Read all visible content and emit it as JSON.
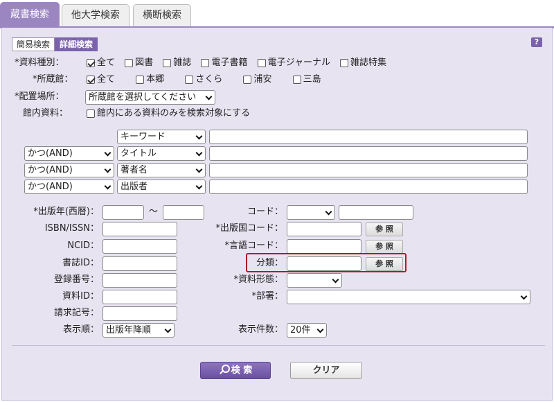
{
  "tabs": [
    {
      "label": "蔵書検索",
      "active": true
    },
    {
      "label": "他大学検索",
      "active": false
    },
    {
      "label": "横断検索",
      "active": false
    }
  ],
  "mode_tabs": [
    {
      "label": "簡易検索",
      "active": false
    },
    {
      "label": "詳細検索",
      "active": true
    }
  ],
  "help": "?",
  "material_type": {
    "label": "*資料種別：",
    "options": [
      {
        "label": "全て",
        "checked": true
      },
      {
        "label": "図書",
        "checked": false
      },
      {
        "label": "雑誌",
        "checked": false
      },
      {
        "label": "電子書籍",
        "checked": false
      },
      {
        "label": "電子ジャーナル",
        "checked": false
      },
      {
        "label": "雑誌特集",
        "checked": false
      }
    ]
  },
  "library": {
    "label": "*所蔵館：",
    "options": [
      {
        "label": "全て",
        "checked": true
      },
      {
        "label": "本郷",
        "checked": false
      },
      {
        "label": "さくら",
        "checked": false
      },
      {
        "label": "浦安",
        "checked": false
      },
      {
        "label": "三島",
        "checked": false
      }
    ]
  },
  "location": {
    "label": "*配置場所：",
    "value": "所蔵館を選択してください"
  },
  "in_library": {
    "label": "館内資料：",
    "option": "館内にある資料のみを検索対象にする",
    "checked": false
  },
  "keyword_rows": [
    {
      "operator": "",
      "field": "キーワード",
      "value": ""
    },
    {
      "operator": "かつ(AND)",
      "field": "タイトル",
      "value": ""
    },
    {
      "operator": "かつ(AND)",
      "field": "著者名",
      "value": ""
    },
    {
      "operator": "かつ(AND)",
      "field": "出版者",
      "value": ""
    }
  ],
  "left_fields": {
    "pub_year": "*出版年(西暦)：",
    "range_sep": "〜",
    "isbn": "ISBN/ISSN：",
    "ncid": "NCID：",
    "biblio_id": "書誌ID：",
    "reg_no": "登録番号：",
    "material_id": "資料ID：",
    "call_no": "請求記号：",
    "sort": "表示順：",
    "sort_value": "出版年降順"
  },
  "right_fields": {
    "code": "コード：",
    "code_value": "",
    "country_code": "*出版国コード：",
    "lang_code": "*言語コード：",
    "classification": "分類：",
    "material_form": "*資料形態：",
    "material_form_value": "",
    "department": "*部署：",
    "department_value": "",
    "count": "表示件数：",
    "count_value": "20件"
  },
  "ref_button": "参 照",
  "buttons": {
    "search": "検 索",
    "clear": "クリア"
  }
}
